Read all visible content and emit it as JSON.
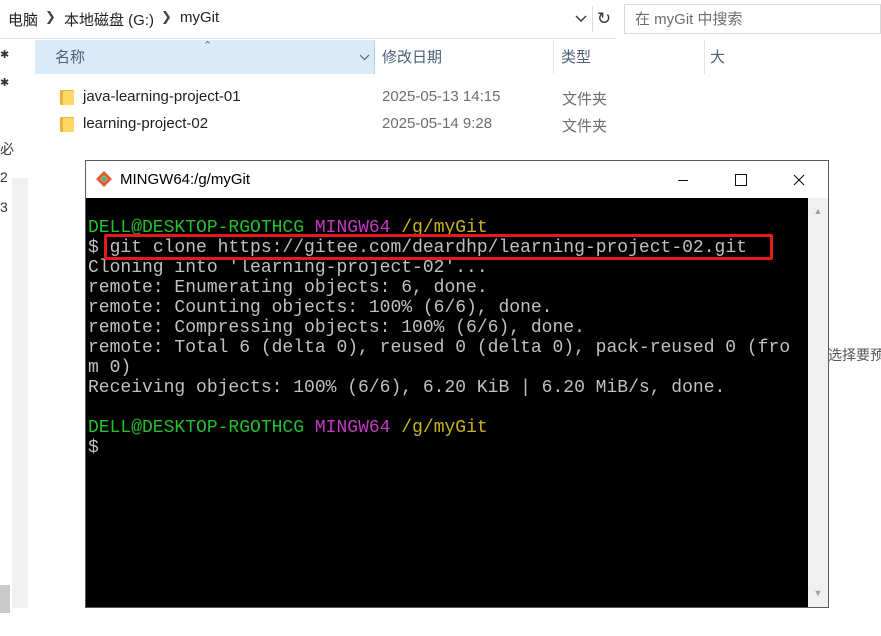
{
  "explorer": {
    "breadcrumb": [
      "电脑",
      "本地磁盘 (G:)",
      "myGit"
    ],
    "search_placeholder": "在 myGit 中搜索",
    "nav_fragments": [
      "必",
      "2",
      "3"
    ],
    "columns": {
      "name": "名称",
      "date": "修改日期",
      "type": "类型",
      "size": "大"
    },
    "files": [
      {
        "name": "java-learning-project-01",
        "date": "2025-05-13 14:15",
        "type": "文件夹"
      },
      {
        "name": "learning-project-02",
        "date": "2025-05-14 9:28",
        "type": "文件夹"
      }
    ],
    "preview_hint": "选择要预"
  },
  "terminal": {
    "title": "MINGW64:/g/myGit",
    "prompt_user": "DELL@DESKTOP-RGOTHCG",
    "prompt_env": "MINGW64",
    "prompt_path": "/g/myGit",
    "prompt_symbol": "$",
    "command": "git clone https://gitee.com/deardhp/learning-project-02.git",
    "output": [
      "Cloning into 'learning-project-02'...",
      "remote: Enumerating objects: 6, done.",
      "remote: Counting objects: 100% (6/6), done.",
      "remote: Compressing objects: 100% (6/6), done.",
      "remote: Total 6 (delta 0), reused 0 (delta 0), pack-reused 0 (fro",
      "m 0)",
      "Receiving objects: 100% (6/6), 6.20 KiB | 6.20 MiB/s, done."
    ]
  },
  "colors": {
    "prompt_user": "#22c02f",
    "prompt_env": "#c43ac4",
    "prompt_path": "#c9b41a",
    "highlight_box": "#e8191a",
    "header_selected": "#d9ebf9",
    "folder": "#ffd766"
  },
  "icons": [
    "chevron-right-icon",
    "chevron-down-icon",
    "refresh-icon",
    "folder-icon",
    "git-icon",
    "minimize-icon",
    "maximize-icon",
    "close-icon",
    "scroll-up-icon",
    "scroll-down-icon"
  ]
}
